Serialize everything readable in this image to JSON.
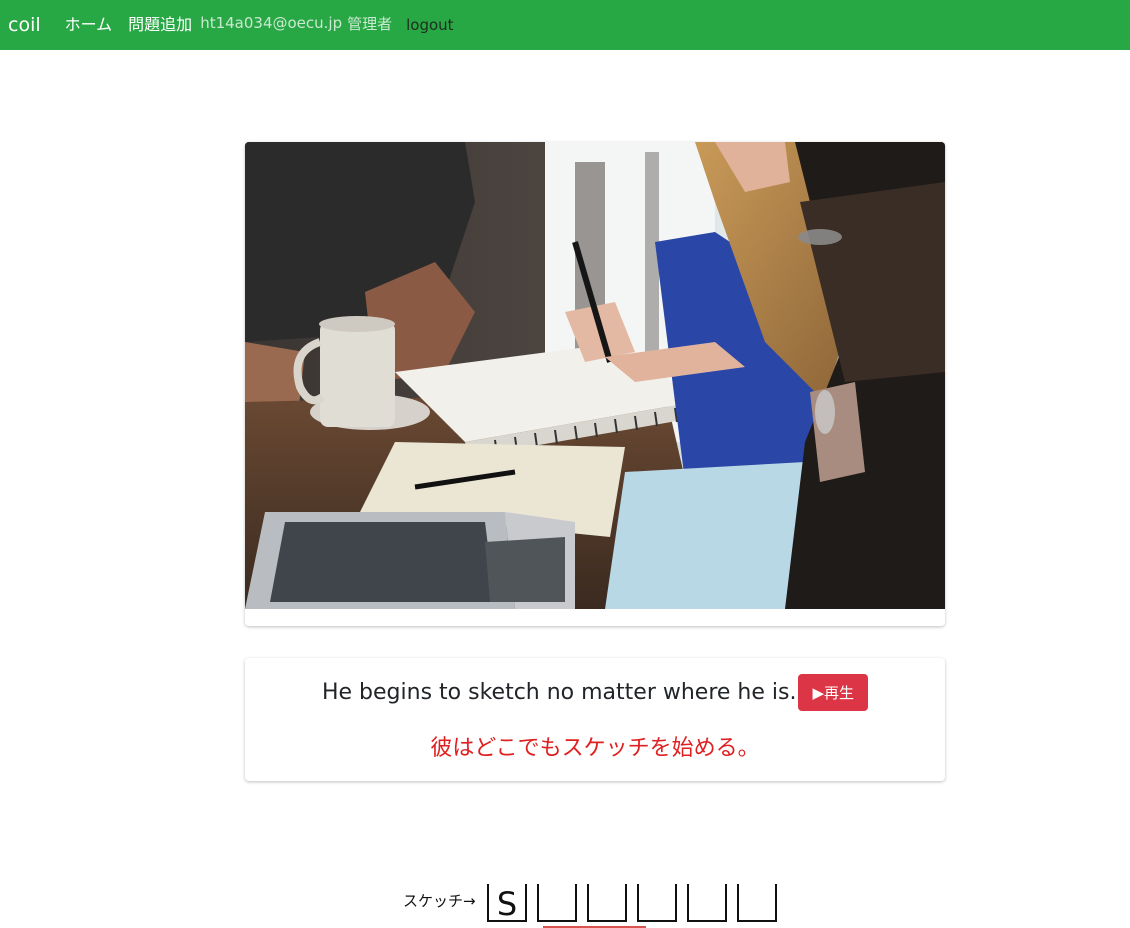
{
  "navbar": {
    "brand": "coil",
    "home_label": "ホーム",
    "add_question_label": "問題追加",
    "user_email": "ht14a034@oecu.jp",
    "user_role": "管理者",
    "logout_label": "logout",
    "color": "#28a745"
  },
  "photo": {
    "icon": "photo-students-sketching-image"
  },
  "sentence": {
    "english": "He begins to sketch no matter where he is.",
    "play_label": "▶再生",
    "japanese": "彼はどこでもスケッチを始める。",
    "play_color": "#dc3545",
    "japanese_color": "#e02020"
  },
  "quiz": {
    "hint": "スケッチ→",
    "letters": [
      "S",
      "",
      "",
      "",
      "",
      ""
    ]
  }
}
